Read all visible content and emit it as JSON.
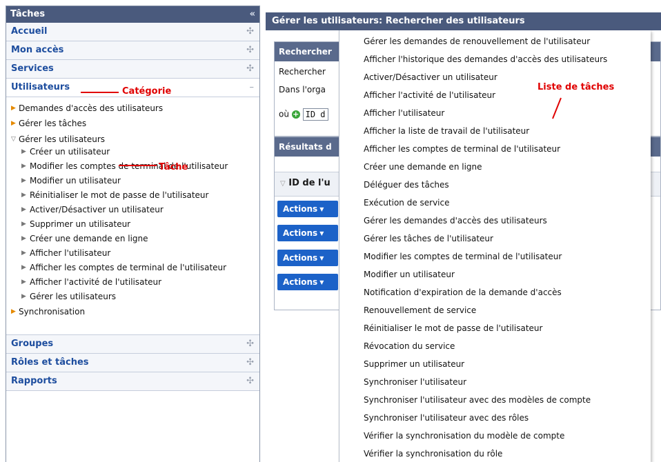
{
  "left": {
    "title": "Tâches",
    "collapse_icon": "«",
    "categories_top": [
      {
        "label": "Accueil",
        "sign": "✣"
      },
      {
        "label": "Mon accès",
        "sign": "✣"
      },
      {
        "label": "Services",
        "sign": "✣"
      }
    ],
    "open_category": {
      "label": "Utilisateurs",
      "sign": "–"
    },
    "tree": {
      "n1": "Demandes d'accès des utilisateurs",
      "n2": "Gérer les tâches",
      "n3": "Gérer les utilisateurs",
      "children": [
        "Créer un utilisateur",
        "Modifier les comptes de terminal de l'utilisateur",
        "Modifier un utilisateur",
        "Réinitialiser le mot de passe de l'utilisateur",
        "Activer/Désactiver un utilisateur",
        "Supprimer un utilisateur",
        "Créer une demande en ligne",
        "Afficher l'utilisateur",
        "Afficher les comptes de terminal de l'utilisateur",
        "Afficher l'activité de l'utilisateur",
        "Gérer les utilisateurs"
      ],
      "n4": "Synchronisation"
    },
    "categories_bottom": [
      {
        "label": "Groupes",
        "sign": "✣"
      },
      {
        "label": "Rôles et tâches",
        "sign": "✣"
      },
      {
        "label": "Rapports",
        "sign": "✣"
      }
    ]
  },
  "annotations": {
    "category": "Catégorie",
    "task": "Tâche",
    "task_list": "Liste de tâches"
  },
  "main": {
    "title": "Gérer les utilisateurs: Rechercher des utilisateurs",
    "search_box_title": "Rechercher",
    "search_line1": "Rechercher",
    "search_line2": "Dans l'orga",
    "where_label": "où",
    "id_field": "ID d",
    "results_title": "Résultats d",
    "column_header": "ID de l'u",
    "actions": [
      "Actions",
      "Actions",
      "Actions",
      "Actions"
    ]
  },
  "menu": {
    "items": [
      "Gérer les demandes de renouvellement de l'utilisateur",
      "Afficher l'historique des demandes d'accès des utilisateurs",
      "Activer/Désactiver un utilisateur",
      "Afficher l'activité de l'utilisateur",
      "Afficher l'utilisateur",
      "Afficher la liste de travail de l'utilisateur",
      "Afficher les comptes de terminal de l'utilisateur",
      "Créer une demande en ligne",
      "Déléguer des tâches",
      "Exécution de service",
      "Gérer les demandes d'accès des utilisateurs",
      "Gérer les tâches de l'utilisateur",
      "Modifier les comptes de terminal de l'utilisateur",
      "Modifier un utilisateur",
      "Notification d'expiration de la demande d'accès",
      "Renouvellement de service",
      "Réinitialiser le mot de passe de l'utilisateur",
      "Révocation du service",
      "Supprimer un utilisateur",
      "Synchroniser l'utilisateur",
      "Synchroniser l'utilisateur avec des modèles de compte",
      "Synchroniser l'utilisateur avec des rôles",
      "Vérifier la synchronisation du modèle de compte",
      "Vérifier la synchronisation du rôle"
    ]
  },
  "colors": {
    "header_bg": "#4a5a7d",
    "category_link": "#1d4d9e",
    "action_button": "#1c62c8",
    "annotation_red": "#e00000"
  }
}
